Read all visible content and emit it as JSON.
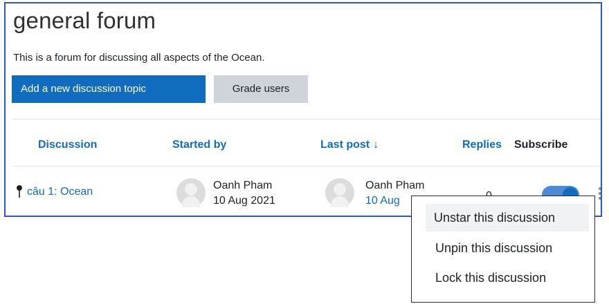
{
  "forum": {
    "title": "general forum",
    "intro": "This is a forum for discussing all aspects of the Ocean."
  },
  "actions": {
    "add_topic": "Add a new discussion topic",
    "grade_users": "Grade users"
  },
  "table": {
    "headers": {
      "discussion": "Discussion",
      "started_by": "Started by",
      "last_post": "Last post",
      "last_post_sort_icon": "↓",
      "replies": "Replies",
      "subscribe": "Subscribe"
    },
    "rows": [
      {
        "discussion": "câu 1: Ocean",
        "started_by_name": "Oanh Pham",
        "started_by_date": "10 Aug 2021",
        "last_post_name": "Oanh Pham",
        "last_post_date": "10 Aug",
        "replies": "0",
        "subscribed": true,
        "pinned": true
      }
    ]
  },
  "dropdown": {
    "items": [
      "Unstar this discussion",
      "Unpin this discussion",
      "Lock this discussion"
    ]
  },
  "colors": {
    "primary": "#0f6cbf",
    "frame_border": "#2f55b8",
    "secondary_button": "#ced4da"
  },
  "icons": [
    "pin-icon",
    "avatar-icon",
    "sort-arrow-icon",
    "toggle-switch",
    "more-actions-icon"
  ]
}
